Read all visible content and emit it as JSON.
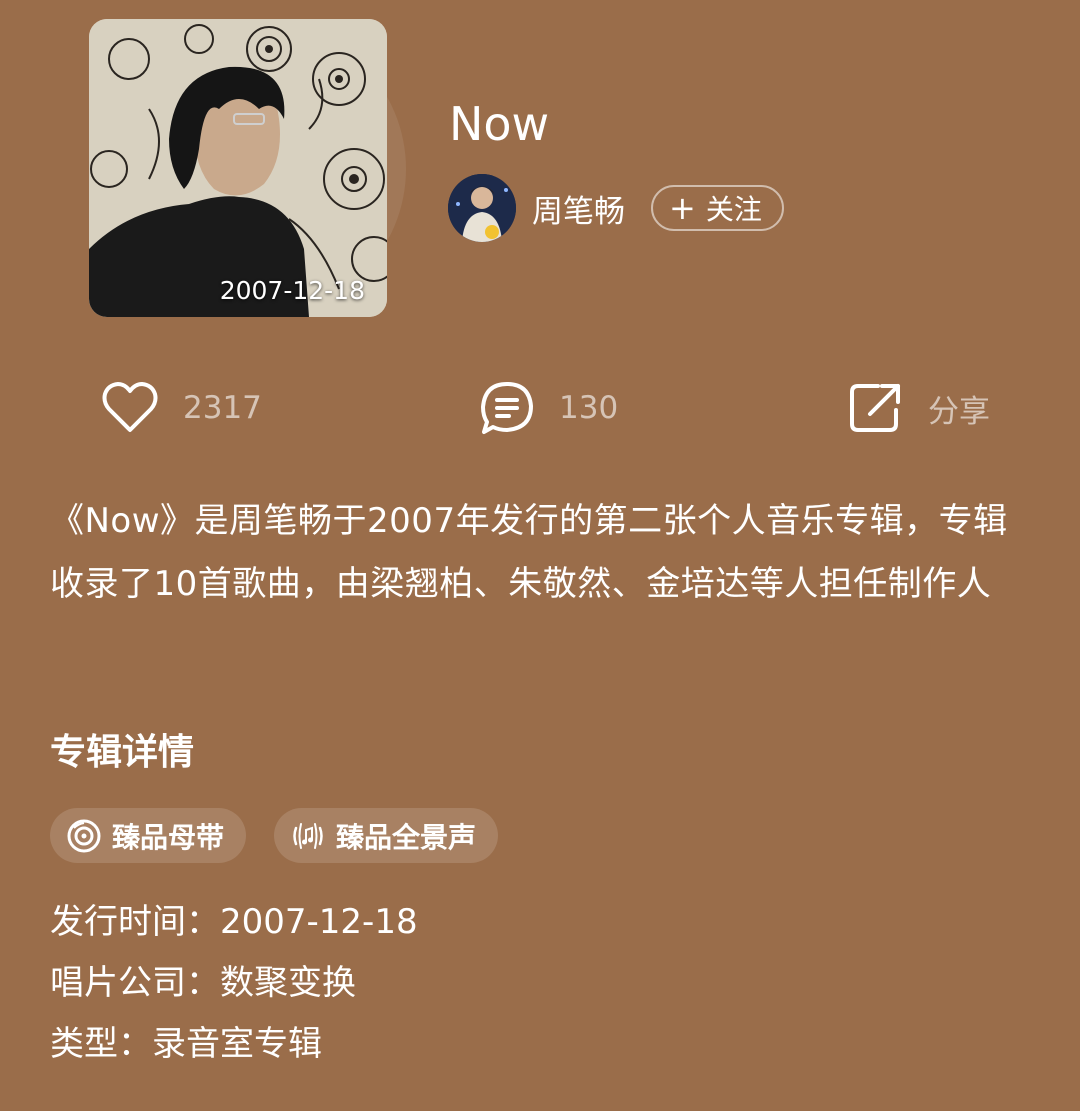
{
  "album": {
    "title": "Now",
    "cover_date": "2007-12-18"
  },
  "artist": {
    "name": "周笔畅",
    "follow_label": "关注"
  },
  "actions": {
    "like_count": "2317",
    "comment_count": "130",
    "share_label": "分享"
  },
  "description": "《Now》是周笔畅于2007年发行的第二张个人音乐专辑，专辑收录了10首歌曲，由梁翘柏、朱敬然、金培达等人担任制作人",
  "details": {
    "section_title": "专辑详情",
    "tags": [
      {
        "label": "臻品母带",
        "icon": "disc-icon"
      },
      {
        "label": "臻品全景声",
        "icon": "surround-sound-icon"
      }
    ],
    "release_label": "发行时间：",
    "release_value": "2007-12-18",
    "label_label": "唱片公司：",
    "label_value": "数聚变换",
    "type_label": "类型：",
    "type_value": "录音室专辑"
  },
  "colors": {
    "background": "#9a6d4a",
    "text": "#ffffff",
    "muted_text": "rgba(255,255,255,0.6)"
  }
}
